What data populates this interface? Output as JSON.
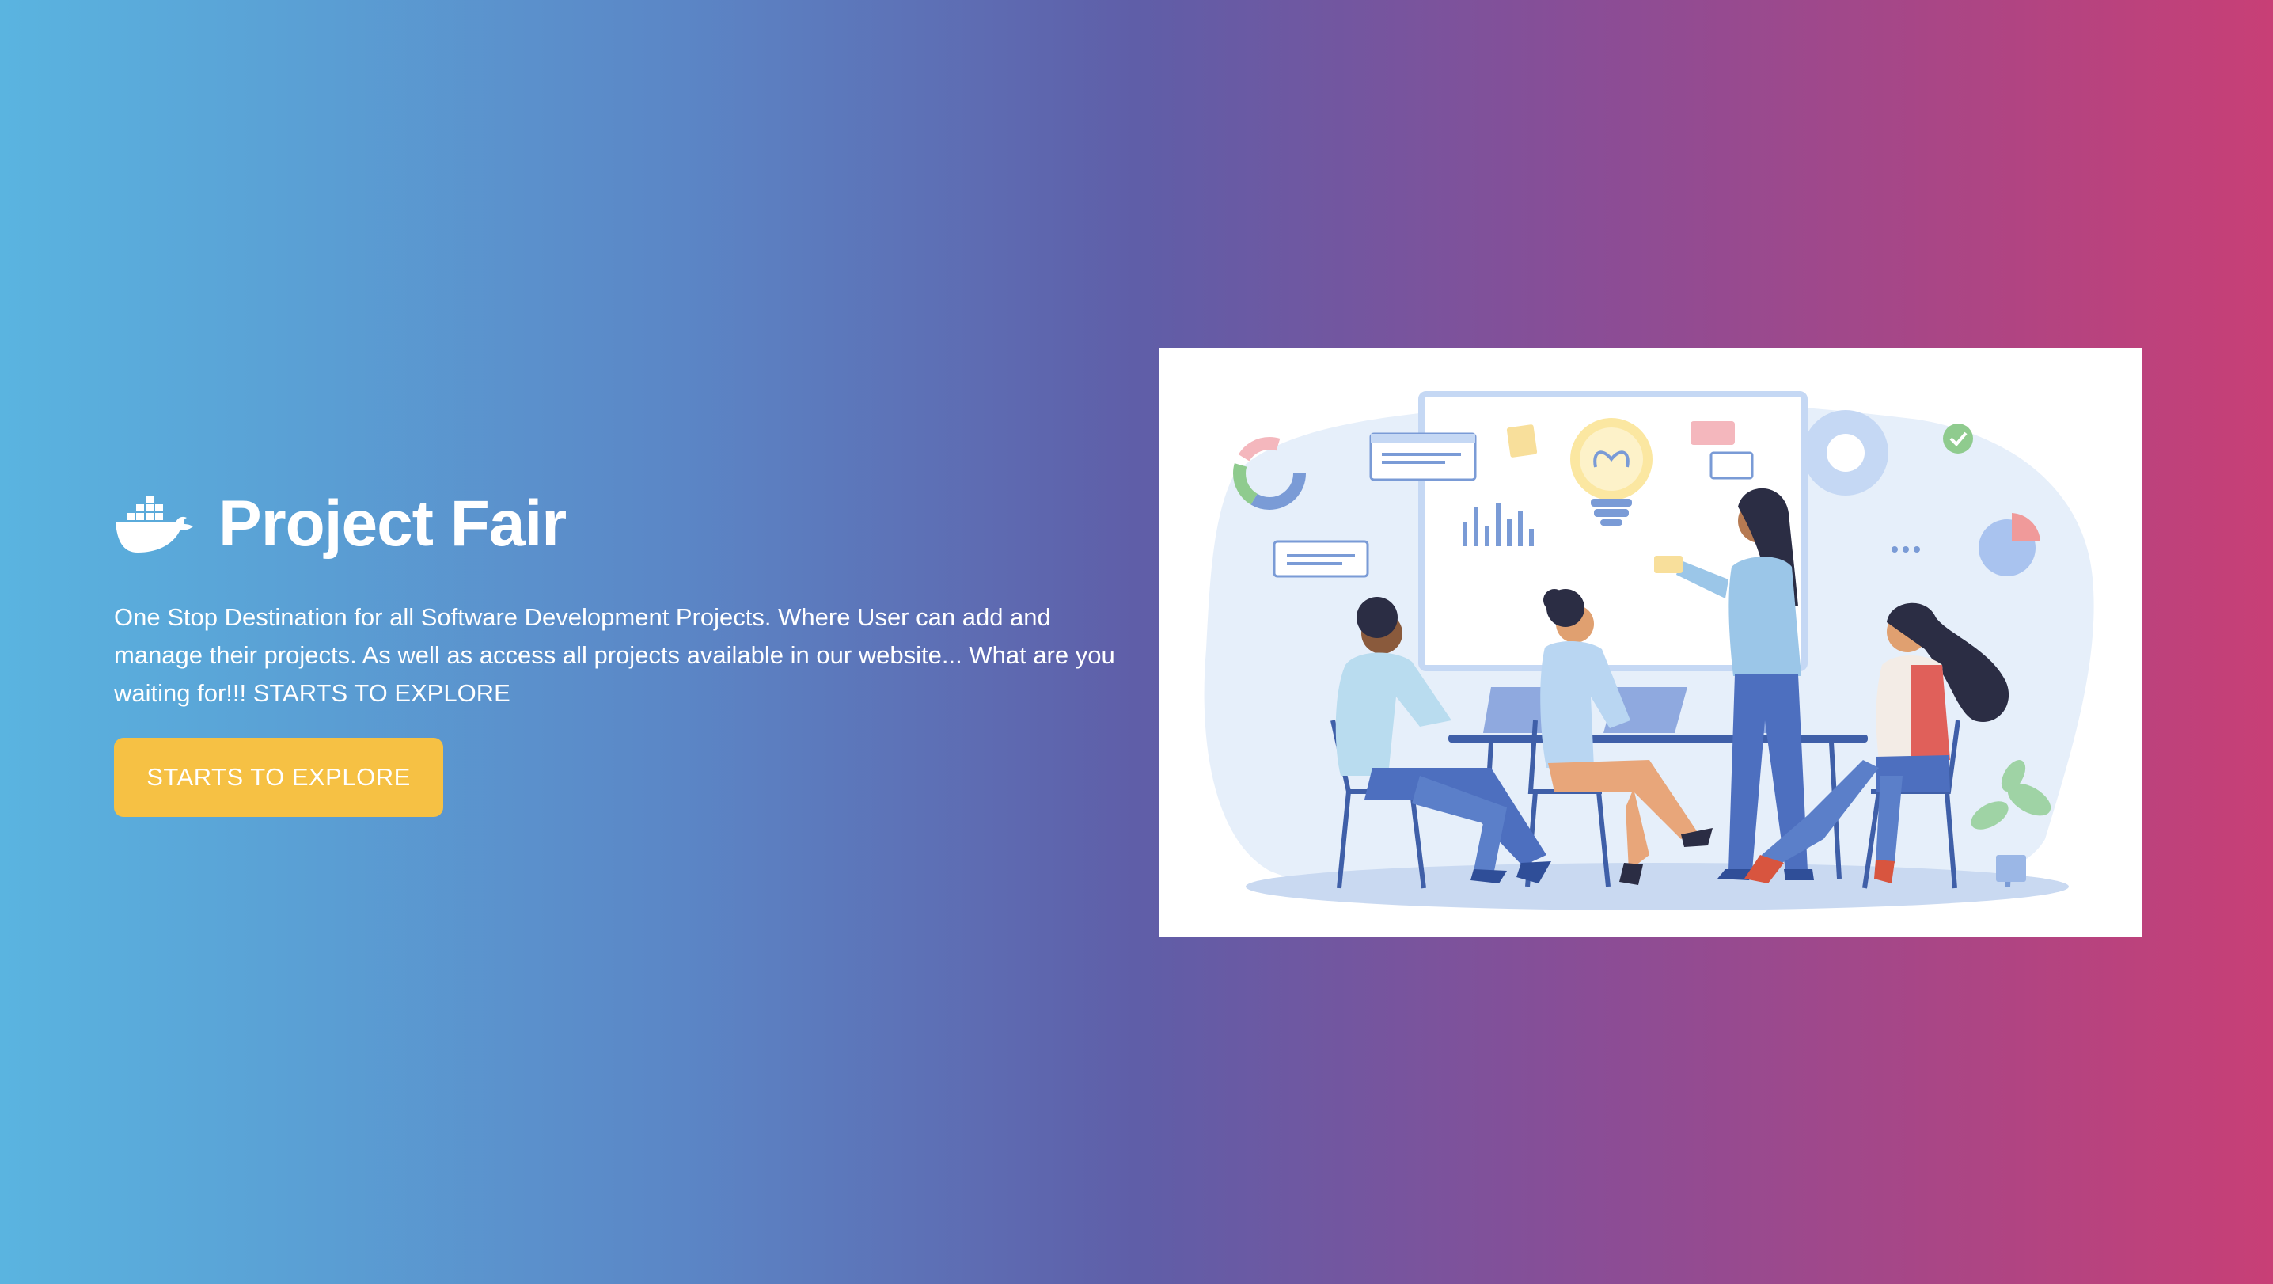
{
  "brand": {
    "icon": "docker-whale-icon",
    "title": "Project Fair"
  },
  "hero": {
    "description": "One Stop Destination for all Software Development Projects. Where User can add and manage their projects. As well as access all projects available in our website... What are you waiting for!!! STARTS TO EXPLORE",
    "cta_label": "STARTS TO EXPLORE"
  },
  "colors": {
    "gradient_start": "#5ab4e0",
    "gradient_mid": "#5f5ea8",
    "gradient_end": "#c83f76",
    "cta_background": "#f6c144"
  },
  "illustration": {
    "subject": "team-meeting-illustration"
  }
}
